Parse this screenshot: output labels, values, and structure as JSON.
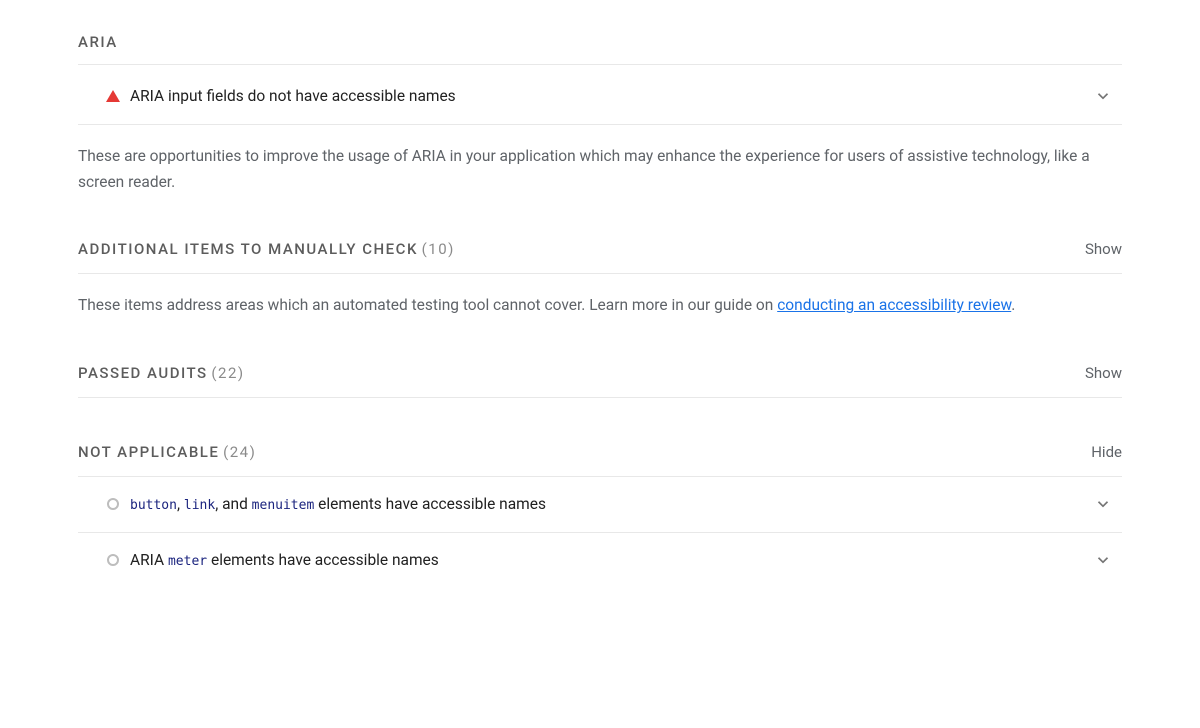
{
  "aria": {
    "title": "ARIA",
    "audits": [
      {
        "title": "ARIA input fields do not have accessible names",
        "status": "fail"
      }
    ],
    "desc": "These are opportunities to improve the usage of ARIA in your application which may enhance the experience for users of assistive technology, like a screen reader."
  },
  "manual": {
    "title": "ADDITIONAL ITEMS TO MANUALLY CHECK",
    "count": "(10)",
    "toggle": "Show",
    "desc_prefix": "These items address areas which an automated testing tool cannot cover. Learn more in our guide on ",
    "desc_link": "conducting an accessibility review",
    "desc_suffix": "."
  },
  "passed": {
    "title": "PASSED AUDITS",
    "count": "(22)",
    "toggle": "Show"
  },
  "na": {
    "title": "NOT APPLICABLE",
    "count": "(24)",
    "toggle": "Hide",
    "audits": [
      {
        "code1": "button",
        "sep1": ", ",
        "code2": "link",
        "sep2": ", and ",
        "code3": "menuitem",
        "rest": " elements have accessible names"
      },
      {
        "prefix": "ARIA ",
        "code1": "meter",
        "rest": " elements have accessible names"
      }
    ]
  }
}
